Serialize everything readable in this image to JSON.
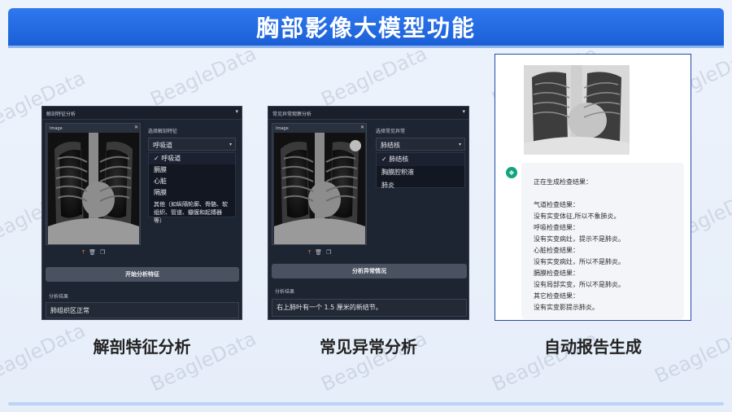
{
  "page": {
    "title": "胸部影像大模型功能",
    "watermark": "BeagleData"
  },
  "panel1": {
    "header": "解剖特征分析",
    "image_tag": "Image",
    "select_label": "选择解剖特征",
    "selected": "呼吸道",
    "options": [
      "呼吸道",
      "膈膜",
      "心脏",
      "隔膜",
      "其他（如纵隔轮廓、骨骼、软组织、管道、瓣膜和起搏器等）"
    ],
    "checked_index": 0,
    "button": "开始分析特征",
    "result_label": "分析结果",
    "result": "肺组织区正常",
    "caption": "解剖特征分析"
  },
  "panel2": {
    "header": "常见异常观察分析",
    "image_tag": "Image",
    "select_label": "选择常见异常",
    "selected": "肺结核",
    "options": [
      "肺结核",
      "胸膜腔积液",
      "肺炎"
    ],
    "checked_index": 0,
    "button": "分析异常情况",
    "result_label": "分析结果",
    "result": "右上肺叶有一个 1.5 厘米的新结节。",
    "caption": "常见异常分析"
  },
  "panel3": {
    "report_lines": [
      "正在生成检查结果：",
      "",
      "气道检查结果：",
      "没有实变体征,所以不象肺炎。",
      "呼吸检查结果：",
      "没有实变病灶，提示不是肺炎。",
      "心脏检查结果：",
      "没有实变病灶，所以不是肺炎。",
      "膈膜检查结果：",
      "没有局部实变，所以不是肺炎。",
      "其它检查结果：",
      "没有实变影提示肺炎。"
    ],
    "caption": "自动报告生成"
  },
  "icons": {
    "upload": "upload-icon",
    "delete": "trash-icon",
    "copy": "copy-icon",
    "bot": "bot-avatar-icon"
  }
}
